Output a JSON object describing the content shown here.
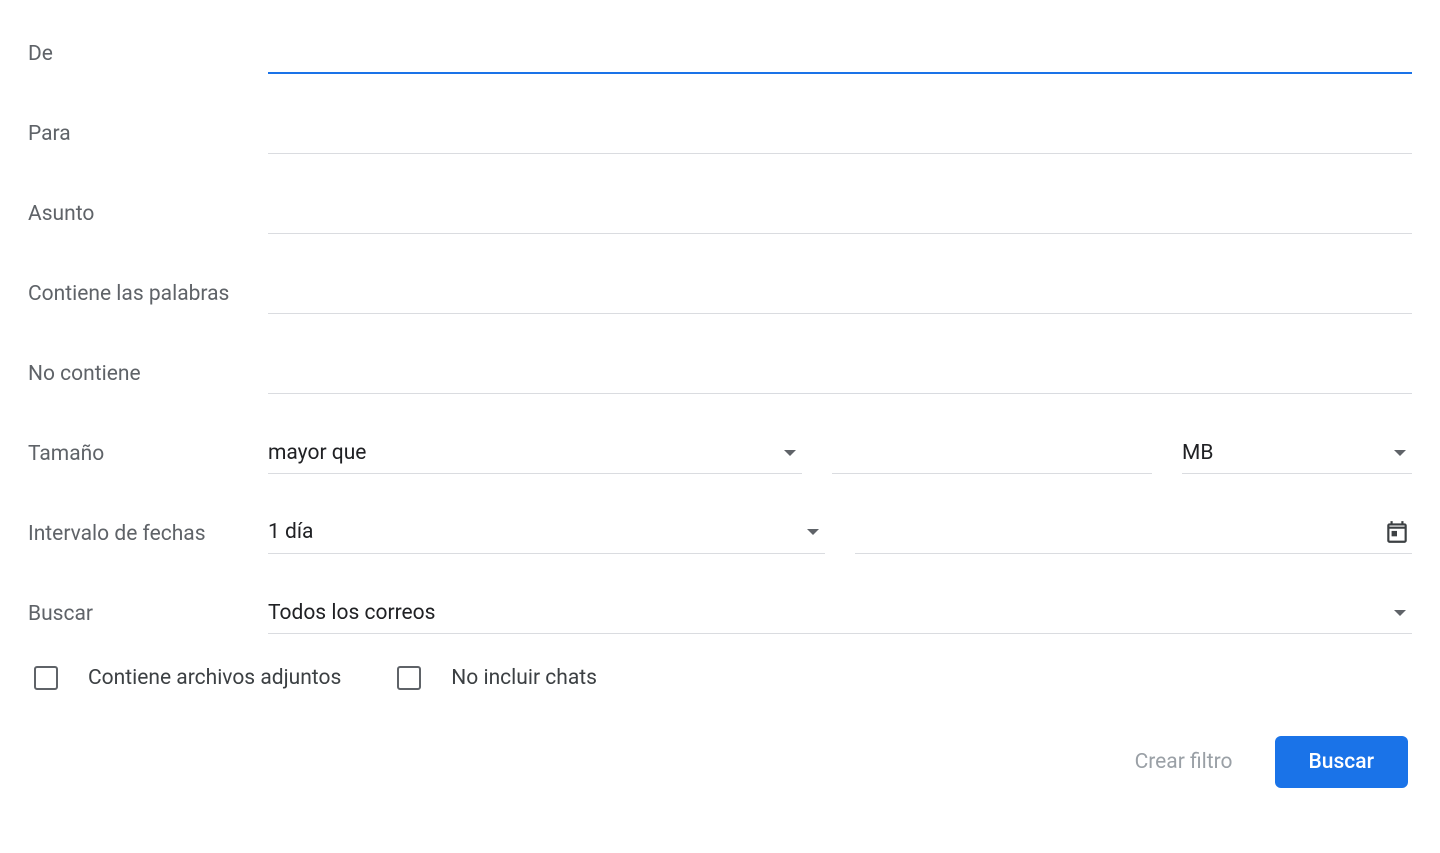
{
  "labels": {
    "from": "De",
    "to": "Para",
    "subject": "Asunto",
    "has_words": "Contiene las palabras",
    "not_has": "No contiene",
    "size": "Tamaño",
    "date_range": "Intervalo de fechas",
    "search": "Buscar"
  },
  "fields": {
    "from_value": "",
    "to_value": "",
    "subject_value": "",
    "has_words_value": "",
    "not_has_value": "",
    "size_comparator": "mayor que",
    "size_number": "",
    "size_unit": "MB",
    "date_range_value": "1 día",
    "date_value": "",
    "search_in": "Todos los correos"
  },
  "checkboxes": {
    "has_attachment": "Contiene archivos adjuntos",
    "exclude_chats": "No incluir chats"
  },
  "actions": {
    "create_filter": "Crear filtro",
    "search_button": "Buscar"
  }
}
